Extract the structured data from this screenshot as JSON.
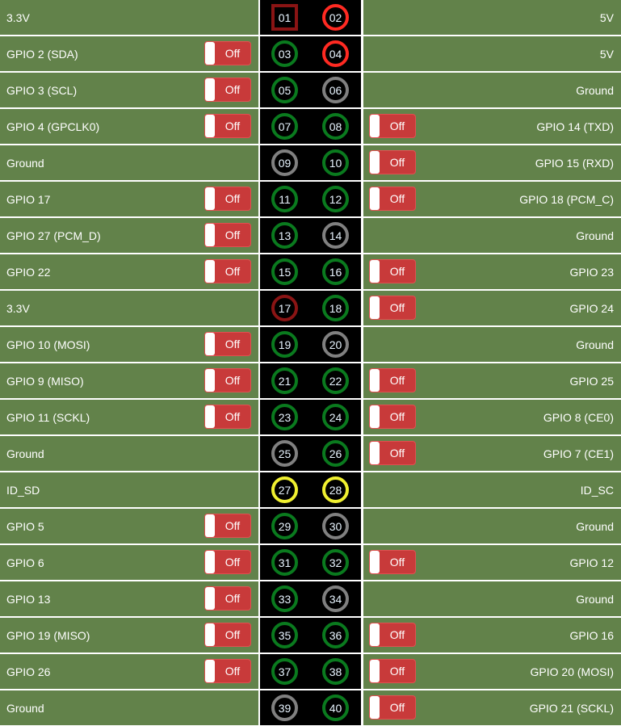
{
  "colors": {
    "gpio": "#0a7a1e",
    "power5v": "#ff2a22",
    "power3v3": "#8a1414",
    "ground": "#808080",
    "id": "#f0f030",
    "cell_bg": "#62824a",
    "toggle_off": "#c83a3a"
  },
  "toggle_off_label": "Off",
  "rows": [
    {
      "left": {
        "label": "3.3V",
        "toggle": false
      },
      "pins": [
        {
          "num": "01",
          "type": "power3v3",
          "shape": "square"
        },
        {
          "num": "02",
          "type": "power5v"
        }
      ],
      "right": {
        "label": "5V",
        "toggle": false
      }
    },
    {
      "left": {
        "label": "GPIO 2 (SDA)",
        "toggle": true
      },
      "pins": [
        {
          "num": "03",
          "type": "gpio"
        },
        {
          "num": "04",
          "type": "power5v"
        }
      ],
      "right": {
        "label": "5V",
        "toggle": false
      }
    },
    {
      "left": {
        "label": "GPIO 3 (SCL)",
        "toggle": true
      },
      "pins": [
        {
          "num": "05",
          "type": "gpio"
        },
        {
          "num": "06",
          "type": "ground"
        }
      ],
      "right": {
        "label": "Ground",
        "toggle": false
      }
    },
    {
      "left": {
        "label": "GPIO 4 (GPCLK0)",
        "toggle": true
      },
      "pins": [
        {
          "num": "07",
          "type": "gpio"
        },
        {
          "num": "08",
          "type": "gpio"
        }
      ],
      "right": {
        "label": "GPIO 14 (TXD)",
        "toggle": true
      }
    },
    {
      "left": {
        "label": "Ground",
        "toggle": false
      },
      "pins": [
        {
          "num": "09",
          "type": "ground"
        },
        {
          "num": "10",
          "type": "gpio"
        }
      ],
      "right": {
        "label": "GPIO 15 (RXD)",
        "toggle": true
      }
    },
    {
      "left": {
        "label": "GPIO 17",
        "toggle": true
      },
      "pins": [
        {
          "num": "11",
          "type": "gpio"
        },
        {
          "num": "12",
          "type": "gpio"
        }
      ],
      "right": {
        "label": "GPIO 18 (PCM_C)",
        "toggle": true
      }
    },
    {
      "left": {
        "label": "GPIO 27 (PCM_D)",
        "toggle": true
      },
      "pins": [
        {
          "num": "13",
          "type": "gpio"
        },
        {
          "num": "14",
          "type": "ground"
        }
      ],
      "right": {
        "label": "Ground",
        "toggle": false
      }
    },
    {
      "left": {
        "label": "GPIO 22",
        "toggle": true
      },
      "pins": [
        {
          "num": "15",
          "type": "gpio"
        },
        {
          "num": "16",
          "type": "gpio"
        }
      ],
      "right": {
        "label": "GPIO 23",
        "toggle": true
      }
    },
    {
      "left": {
        "label": "3.3V",
        "toggle": false
      },
      "pins": [
        {
          "num": "17",
          "type": "power3v3"
        },
        {
          "num": "18",
          "type": "gpio"
        }
      ],
      "right": {
        "label": "GPIO 24",
        "toggle": true
      }
    },
    {
      "left": {
        "label": "GPIO 10 (MOSI)",
        "toggle": true
      },
      "pins": [
        {
          "num": "19",
          "type": "gpio"
        },
        {
          "num": "20",
          "type": "ground"
        }
      ],
      "right": {
        "label": "Ground",
        "toggle": false
      }
    },
    {
      "left": {
        "label": "GPIO 9 (MISO)",
        "toggle": true
      },
      "pins": [
        {
          "num": "21",
          "type": "gpio"
        },
        {
          "num": "22",
          "type": "gpio"
        }
      ],
      "right": {
        "label": "GPIO 25",
        "toggle": true
      }
    },
    {
      "left": {
        "label": "GPIO 11 (SCKL)",
        "toggle": true
      },
      "pins": [
        {
          "num": "23",
          "type": "gpio"
        },
        {
          "num": "24",
          "type": "gpio"
        }
      ],
      "right": {
        "label": "GPIO 8 (CE0)",
        "toggle": true
      }
    },
    {
      "left": {
        "label": "Ground",
        "toggle": false
      },
      "pins": [
        {
          "num": "25",
          "type": "ground"
        },
        {
          "num": "26",
          "type": "gpio"
        }
      ],
      "right": {
        "label": "GPIO 7 (CE1)",
        "toggle": true
      }
    },
    {
      "left": {
        "label": "ID_SD",
        "toggle": false
      },
      "pins": [
        {
          "num": "27",
          "type": "id"
        },
        {
          "num": "28",
          "type": "id"
        }
      ],
      "right": {
        "label": "ID_SC",
        "toggle": false
      }
    },
    {
      "left": {
        "label": "GPIO 5",
        "toggle": true
      },
      "pins": [
        {
          "num": "29",
          "type": "gpio"
        },
        {
          "num": "30",
          "type": "ground"
        }
      ],
      "right": {
        "label": "Ground",
        "toggle": false
      }
    },
    {
      "left": {
        "label": "GPIO 6",
        "toggle": true
      },
      "pins": [
        {
          "num": "31",
          "type": "gpio"
        },
        {
          "num": "32",
          "type": "gpio"
        }
      ],
      "right": {
        "label": "GPIO 12",
        "toggle": true
      }
    },
    {
      "left": {
        "label": "GPIO 13",
        "toggle": true
      },
      "pins": [
        {
          "num": "33",
          "type": "gpio"
        },
        {
          "num": "34",
          "type": "ground"
        }
      ],
      "right": {
        "label": "Ground",
        "toggle": false
      }
    },
    {
      "left": {
        "label": "GPIO 19 (MISO)",
        "toggle": true
      },
      "pins": [
        {
          "num": "35",
          "type": "gpio"
        },
        {
          "num": "36",
          "type": "gpio"
        }
      ],
      "right": {
        "label": "GPIO 16",
        "toggle": true
      }
    },
    {
      "left": {
        "label": "GPIO 26",
        "toggle": true
      },
      "pins": [
        {
          "num": "37",
          "type": "gpio"
        },
        {
          "num": "38",
          "type": "gpio"
        }
      ],
      "right": {
        "label": "GPIO 20 (MOSI)",
        "toggle": true
      }
    },
    {
      "left": {
        "label": "Ground",
        "toggle": false
      },
      "pins": [
        {
          "num": "39",
          "type": "ground"
        },
        {
          "num": "40",
          "type": "gpio"
        }
      ],
      "right": {
        "label": "GPIO 21 (SCKL)",
        "toggle": true
      }
    }
  ]
}
